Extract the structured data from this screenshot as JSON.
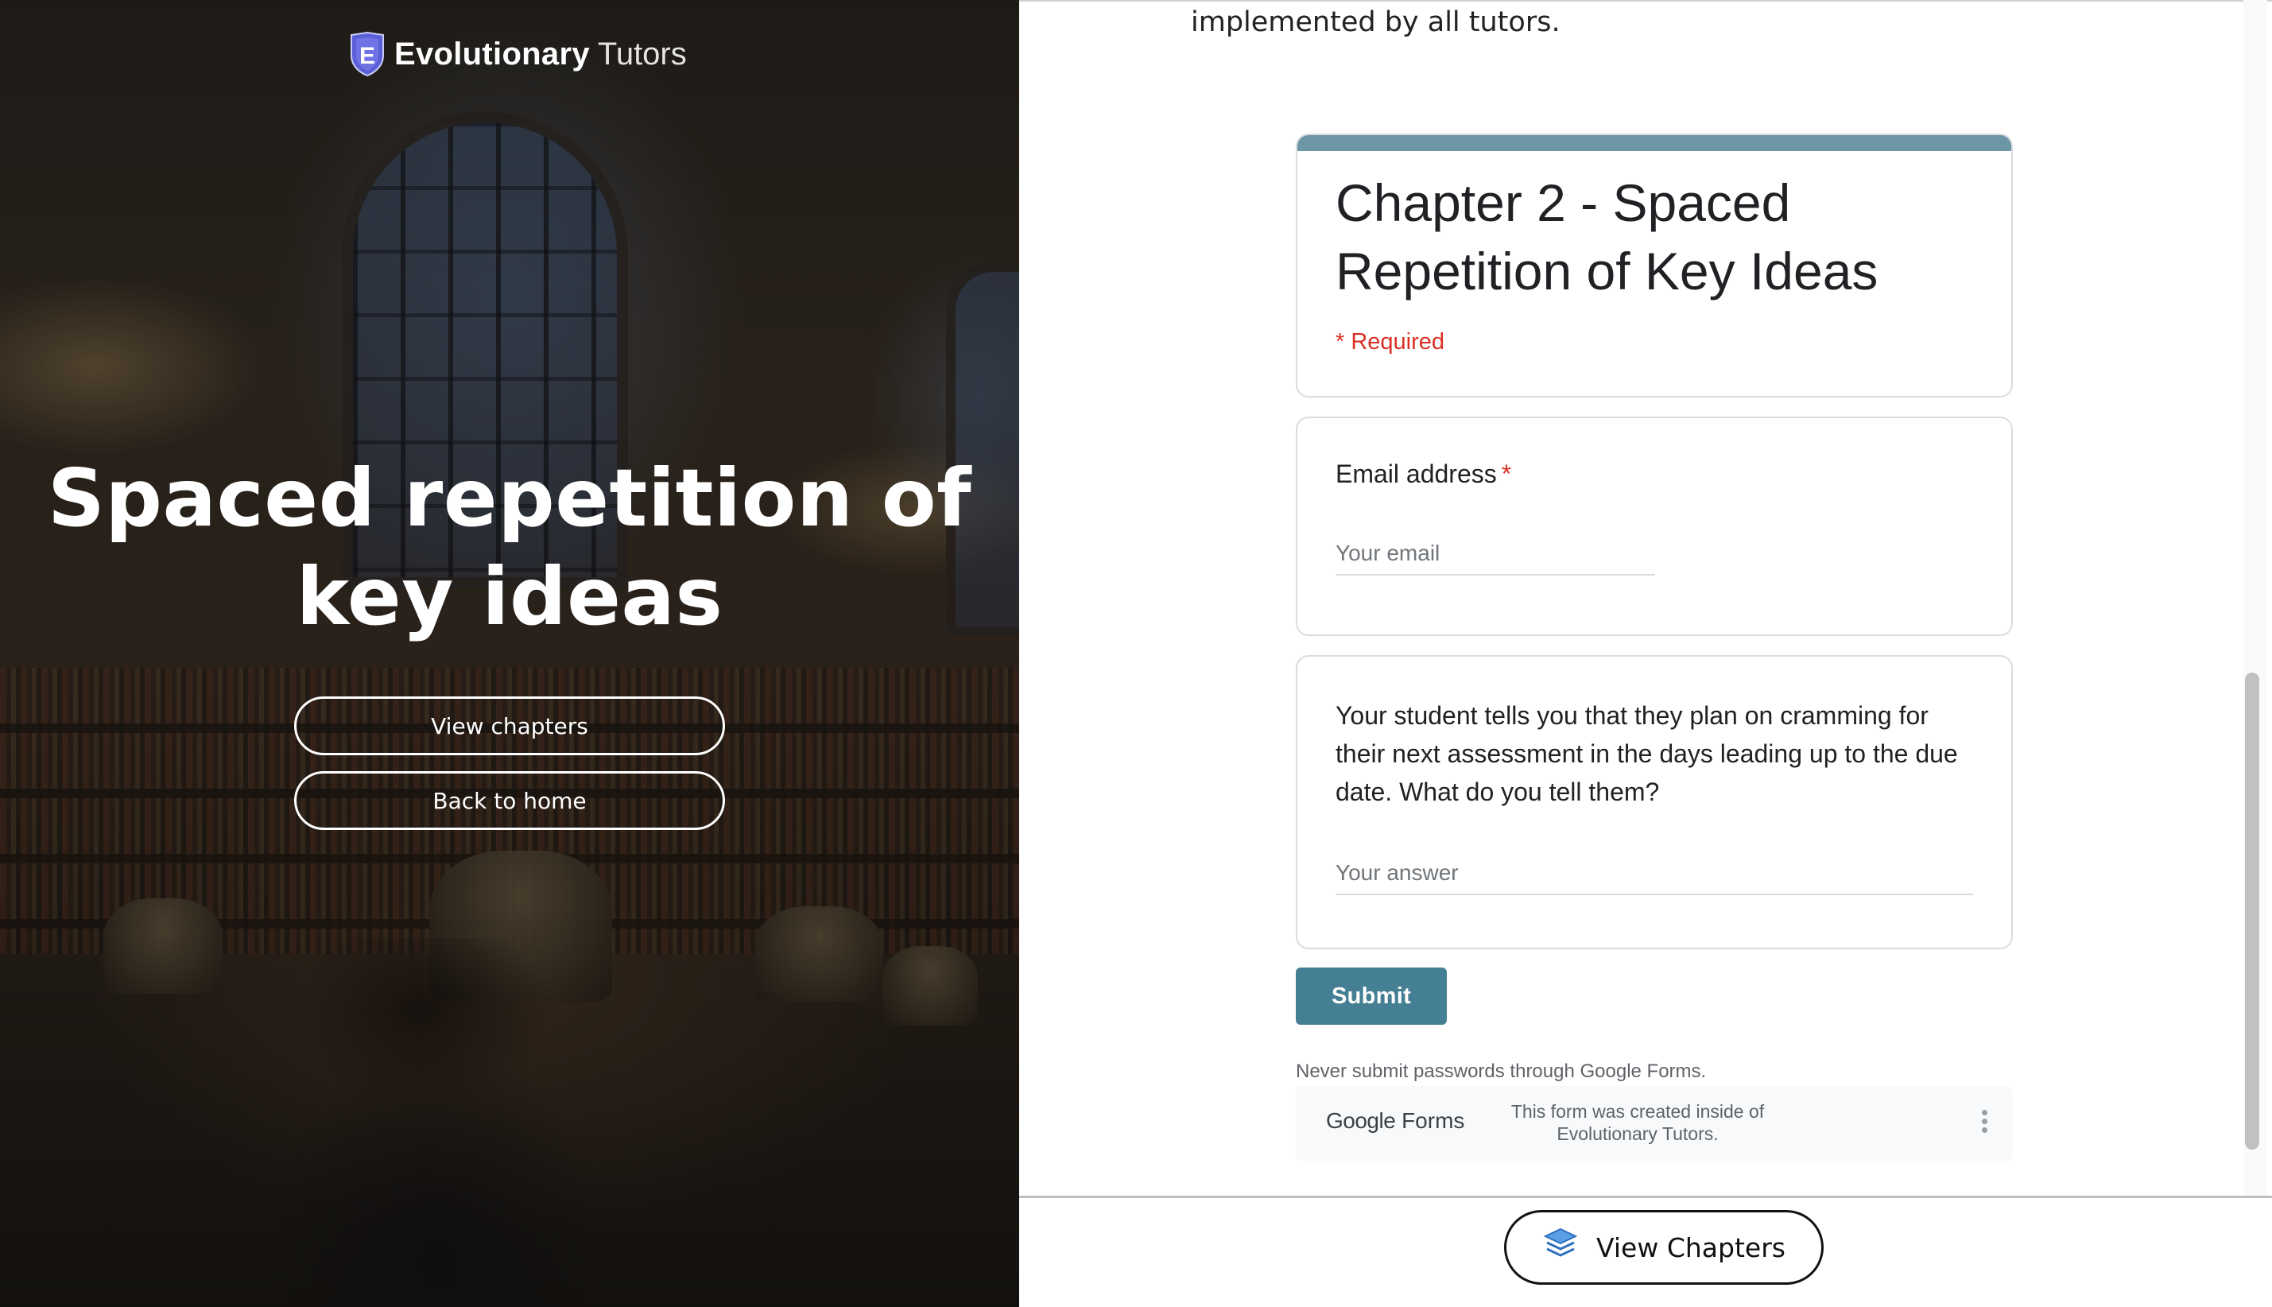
{
  "brand": {
    "name_bold": "Evolutionary",
    "name_light": "Tutors",
    "logo_letter": "E"
  },
  "hero": {
    "title": "Spaced repetition of key ideas",
    "buttons": {
      "view_chapters": "View chapters",
      "back_home": "Back to home"
    }
  },
  "page": {
    "top_text": "implemented by all tutors."
  },
  "form": {
    "title": "Chapter 2 - Spaced Repetition of Key Ideas",
    "required_note": "* Required",
    "email": {
      "label": "Email address",
      "required_mark": "*",
      "placeholder": "Your email"
    },
    "question": {
      "text": "Your student tells you that they plan on cramming for their next assessment in the days leading up to the due date. What do you tell them?",
      "placeholder": "Your answer"
    },
    "submit_label": "Submit",
    "password_note": "Never submit passwords through Google Forms.",
    "footer": {
      "logo_google": "Google",
      "logo_forms": "Forms",
      "created_line1": "This form was created inside of",
      "created_line2": "Evolutionary Tutors."
    }
  },
  "bottom": {
    "view_chapters_label": "View Chapters"
  },
  "colors": {
    "accent": "#6c95a6",
    "submit": "#457f93",
    "required": "#d93025",
    "shield_outer": "#5b5fd6",
    "shield_inner": "#ffffff"
  },
  "icons": {
    "shield": "shield-logo-icon",
    "layers": "layers-stack-icon",
    "kebab": "more-vert-icon"
  }
}
